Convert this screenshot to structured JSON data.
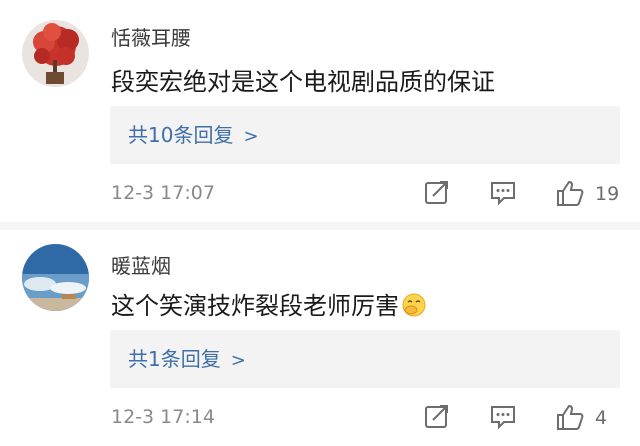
{
  "comments": [
    {
      "username": "恬薇耳腰",
      "text": "段奕宏绝对是这个电视剧品质的保证",
      "replies_label": "共10条回复",
      "time": "12-3 17:07",
      "likes": "19",
      "avatar_icon": "red-tree-avatar",
      "has_emoji": false
    },
    {
      "username": "暖蓝烟",
      "text": "这个笑演技炸裂段老师厉害",
      "replies_label": "共1条回复",
      "time": "12-3 17:14",
      "likes": "4",
      "avatar_icon": "blue-sky-avatar",
      "has_emoji": true,
      "emoji_icon": "hand-over-mouth-emoji"
    }
  ],
  "colors": {
    "reply_link": "#3f6fa8",
    "meta_gray": "#8a8a8a",
    "panel_bg": "#f3f3f3"
  }
}
